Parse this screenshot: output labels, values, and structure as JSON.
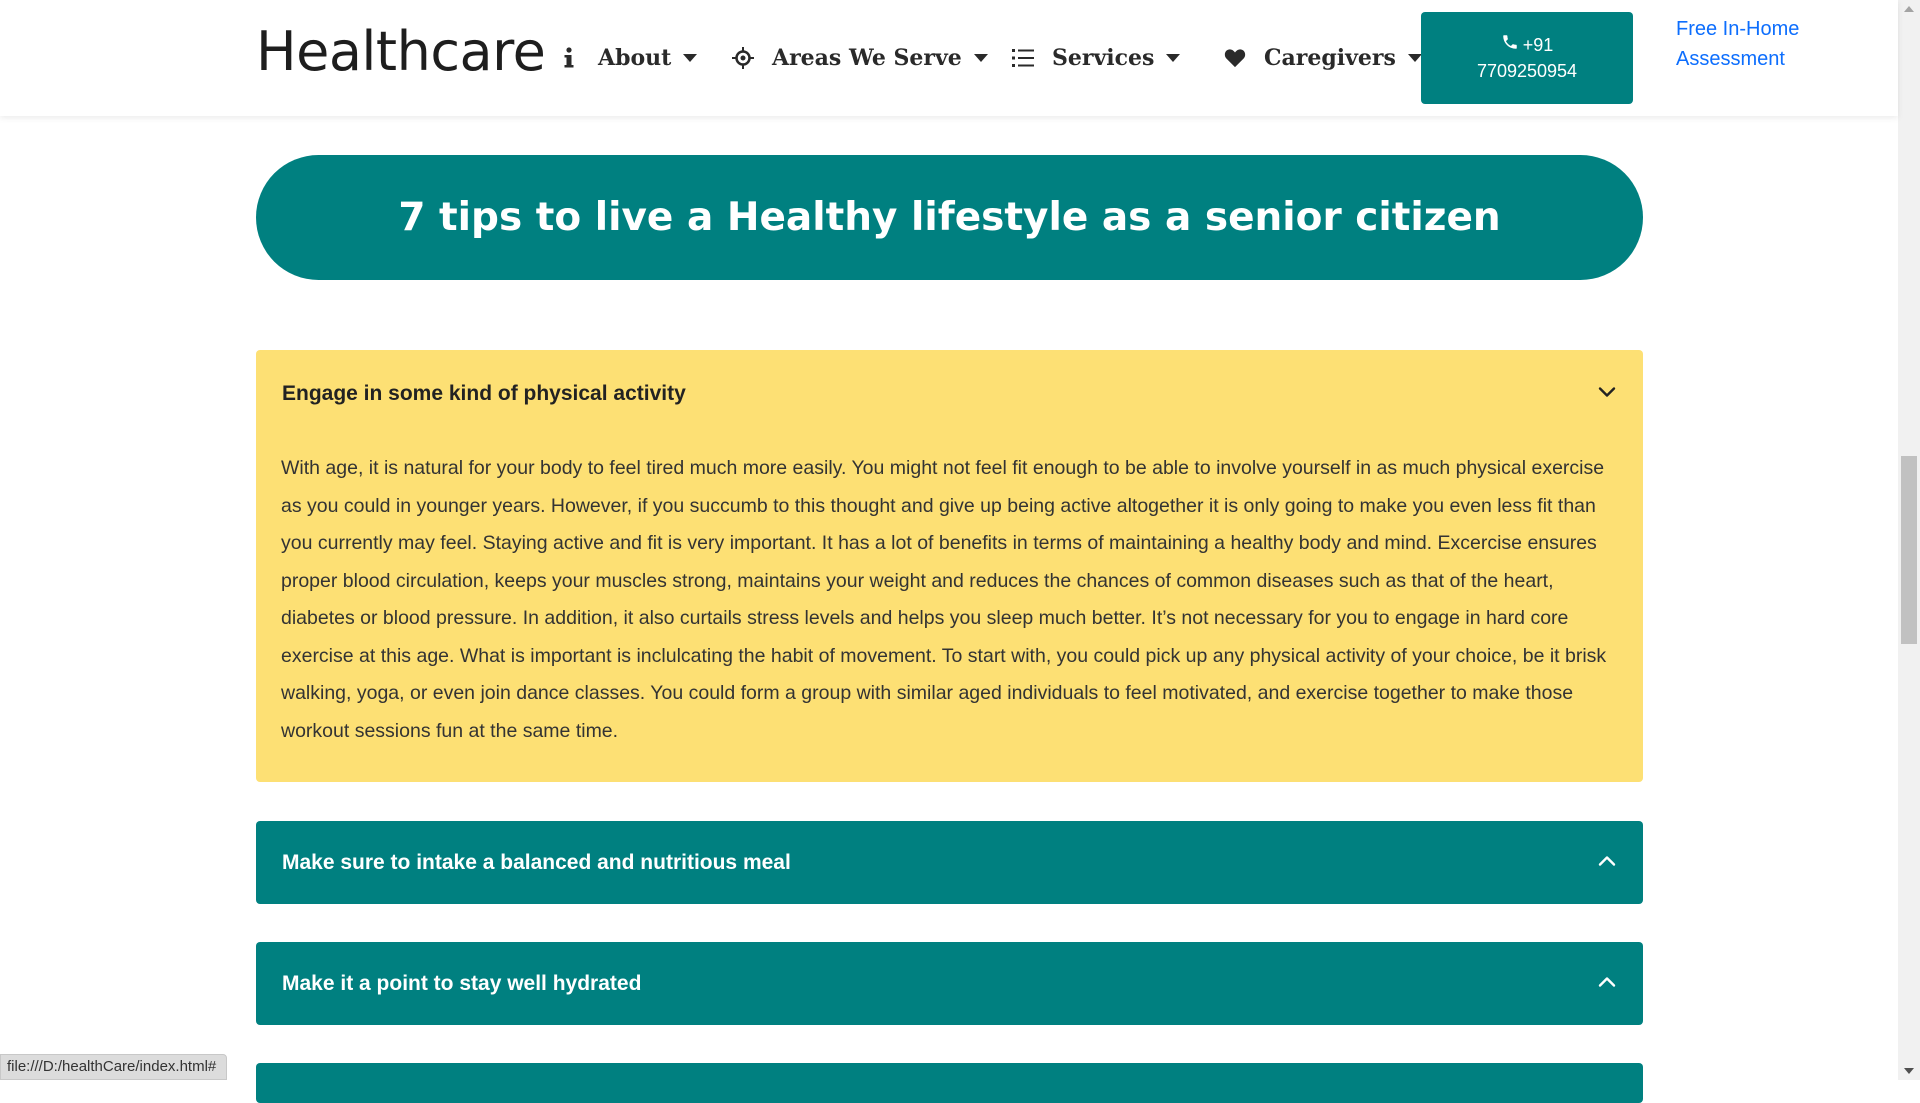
{
  "navbar": {
    "brand": "Healthcare",
    "items": [
      {
        "label": "About",
        "icon": "info-icon"
      },
      {
        "label": "Areas We Serve",
        "icon": "crosshair-icon"
      },
      {
        "label": "Services",
        "icon": "list-icon"
      },
      {
        "label": "Caregivers",
        "icon": "heart-icon"
      }
    ],
    "phone": {
      "line1": "+91",
      "line2": "7709250954",
      "icon": "phone-icon"
    },
    "assessment_link": "Free In-Home Assessment"
  },
  "hero": {
    "title": "7 tips to live a Healthy lifestyle as a senior citizen"
  },
  "accordion": [
    {
      "title": "Engage in some kind of physical activity",
      "expanded": true,
      "body": "With age, it is natural for your body to feel tired much more easily. You might not feel fit enough to be able to involve yourself in as much physical exercise as you could in younger years. However, if you succumb to this thought and give up being active altogether it is only going to make you even less fit than you currently may feel. Staying active and fit is very important. It has a lot of benefits in terms of maintaining a healthy body and mind. Excercise ensures proper blood circulation, keeps your muscles strong, maintains your weight and reduces the chances of common diseases such as that of the heart, diabetes or blood pressure. In addition, it also curtails stress levels and helps you sleep much better. It’s not necessary for you to engage in hard core exercise at this age. What is important is inclulcating the habit of movement. To start with, you could pick up any physical activity of your choice, be it brisk walking, yoga, or even join dance classes. You could form a group with similar aged individuals to feel motivated, and exercise together to make those workout sessions fun at the same time."
    },
    {
      "title": "Make sure to intake a balanced and nutritious meal",
      "expanded": false
    },
    {
      "title": "Make it a point to stay well hydrated",
      "expanded": false
    }
  ],
  "status_bar": {
    "url": "file:///D:/healthCare/index.html#"
  },
  "colors": {
    "teal": "#008080",
    "yellow": "#fde074",
    "link_blue": "#0d6efd"
  }
}
